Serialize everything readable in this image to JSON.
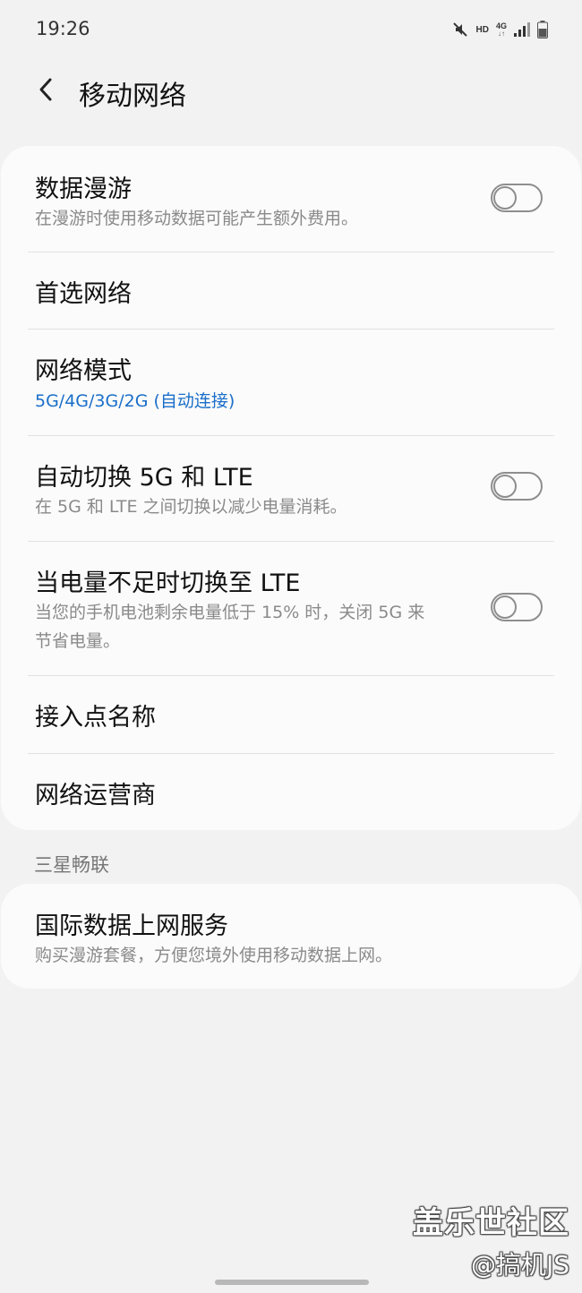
{
  "status_bar": {
    "time": "19:26",
    "hd_label": "HD",
    "network_label": "4G",
    "icons": [
      "mute-icon",
      "hd-icon",
      "network-4g-icon",
      "signal-icon",
      "battery-icon"
    ]
  },
  "header": {
    "back_icon": "chevron-left-icon",
    "title": "移动网络"
  },
  "settings": [
    {
      "title": "数据漫游",
      "subtitle": "在漫游时使用移动数据可能产生额外费用。",
      "toggle": false
    },
    {
      "title": "首选网络"
    },
    {
      "title": "网络模式",
      "subtitle": "5G/4G/3G/2G (自动连接)",
      "subtitle_color": "#1a6ec9"
    },
    {
      "title": "自动切换 5G 和 LTE",
      "subtitle": "在 5G 和 LTE 之间切换以减少电量消耗。",
      "toggle": false
    },
    {
      "title": "当电量不足时切换至 LTE",
      "subtitle_line1": "当您的手机电池剩余电量低于 15% 时，关闭 5G 来",
      "subtitle_line2": "节省电量。",
      "toggle": false
    },
    {
      "title": "接入点名称"
    },
    {
      "title": "网络运营商"
    }
  ],
  "section": {
    "header": "三星畅联",
    "item": {
      "title": "国际数据上网服务",
      "subtitle": "购买漫游套餐，方便您境外使用移动数据上网。"
    }
  },
  "watermark": {
    "logo": "盖乐世社区",
    "handle": "@搞机JS"
  },
  "colors": {
    "background": "#f2f2f2",
    "card": "#fbfbfb",
    "accent_blue": "#1a6ec9",
    "subtitle_gray": "#8a8a8a"
  }
}
